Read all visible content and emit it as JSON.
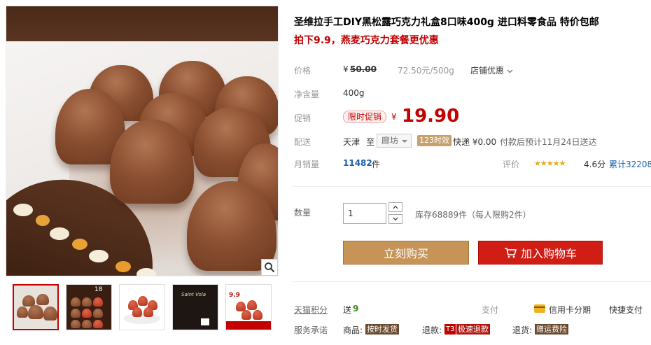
{
  "product": {
    "title": "圣维拉手工DIY黑松露巧克力礼盒8口味400g 进口料零食品 特价包邮",
    "subtitle": "拍下9.9，燕麦巧克力套餐更优惠"
  },
  "price": {
    "label": "价格",
    "currency": "¥",
    "original": "50.00",
    "unit_price": "72.50元/500g",
    "shop_discount": "店铺优惠"
  },
  "net_weight": {
    "label": "净含量",
    "value": "400g"
  },
  "promo": {
    "label": "促销",
    "tag": "限时促销",
    "currency": "¥",
    "price": "19.90"
  },
  "delivery": {
    "label": "配送",
    "from": "天津",
    "to_word": "至",
    "destination": "廊坊",
    "badge": "123时效",
    "shipping": "快递 ¥0.00",
    "eta": "付款后预计11月24日送达"
  },
  "sales": {
    "label": "月销量",
    "count": "11482",
    "unit": "件",
    "rating_label": "评价",
    "stars": "★★★★★",
    "rating": 4.6,
    "rating_text": "4.6分",
    "review_total": "累计32208"
  },
  "quantity": {
    "label": "数量",
    "value": "1",
    "stock": "库存68889件",
    "limit": "（每人限购2件）"
  },
  "buttons": {
    "buy_now": "立刻购买",
    "add_to_cart": "加入购物车"
  },
  "footer": {
    "points_label": "天猫积分",
    "points_prefix": "送",
    "points_value": "9",
    "pay_label": "支付",
    "credit_card": "信用卡分期",
    "quick_pay": "快捷支付",
    "service_label": "服务承诺",
    "goods_label": "商品:",
    "goods_tag": "按时发货",
    "refund_label": "退款:",
    "refund_t3": "T3",
    "refund_tag": "极速退款",
    "return_label": "退货:",
    "return_tag": "赠运费险"
  },
  "thumbnails": [
    {
      "name": "thumb-1-truffles-plate"
    },
    {
      "name": "thumb-2-box-red"
    },
    {
      "name": "thumb-3-truffles-bowl"
    },
    {
      "name": "thumb-4-dark-box"
    },
    {
      "name": "thumb-5-promo-9.9"
    }
  ],
  "thumb_text": {
    "t2": "18",
    "t4": "Saint Vola",
    "t5": "9.9"
  },
  "colors": {
    "accent_red": "#c40000",
    "buy_button": "#c69456",
    "cart_button": "#d01e14"
  },
  "icons": [
    "zoom-icon",
    "cart-icon",
    "chevron-down-icon",
    "credit-card-icon",
    "stepper-up-icon",
    "stepper-down-icon"
  ]
}
